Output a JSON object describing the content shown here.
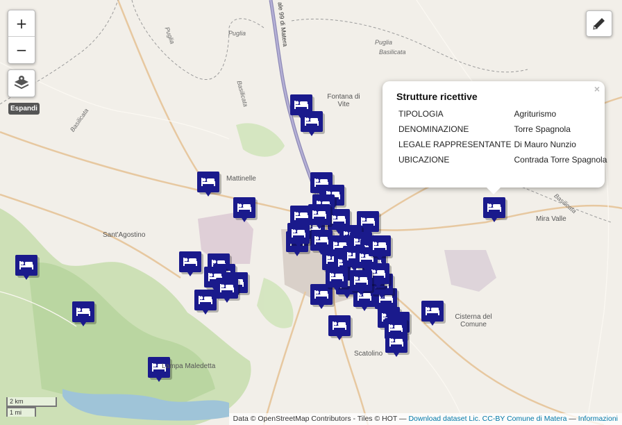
{
  "controls": {
    "zoom_in": "+",
    "zoom_out": "−",
    "layers_icon": "layers-icon",
    "expand_label": "Espandi",
    "edit_icon": "pencil-icon"
  },
  "popup": {
    "title": "Strutture ricettive",
    "close": "×",
    "rows": [
      {
        "key": "TIPOLOGIA",
        "value": "Agriturismo"
      },
      {
        "key": "DENOMINAZIONE",
        "value": "Torre Spagnola"
      },
      {
        "key": "LEGALE RAPPRESENTANTE",
        "value": "Di Mauro Nunzio"
      },
      {
        "key": "UBICAZIONE",
        "value": "Contrada Torre Spagnola"
      }
    ]
  },
  "places": {
    "fontana": "Fontana di Vite",
    "mattinelle": "Mattinelle",
    "santagostino": "Sant'Agostino",
    "cisterna": "Cisterna del Comune",
    "scatolino": "Scatolino",
    "miravalle": "Mira Valle",
    "maledetta": "Lampa Maledetta"
  },
  "roads": {
    "puglia1": "Puglia",
    "puglia2": "Puglia",
    "puglia3": "Puglia",
    "basilicata1": "Basilicata",
    "basilicata2": "Basilicata",
    "basilicata3": "Basilicata",
    "basilicata4": "Basilicata",
    "matera": "ale 99 di Matera"
  },
  "scale": {
    "metric": "2 km",
    "imperial": "1 mi"
  },
  "attribution": {
    "text": "Data © OpenStreetMap Contributors - Tiles © HOT — ",
    "link1": "Download dataset Lic. CC-BY Comune di Matera",
    "sep": " — ",
    "link2": "Informazioni"
  },
  "marker_color": "#1a1a8c",
  "marker_icon": "bed-icon"
}
